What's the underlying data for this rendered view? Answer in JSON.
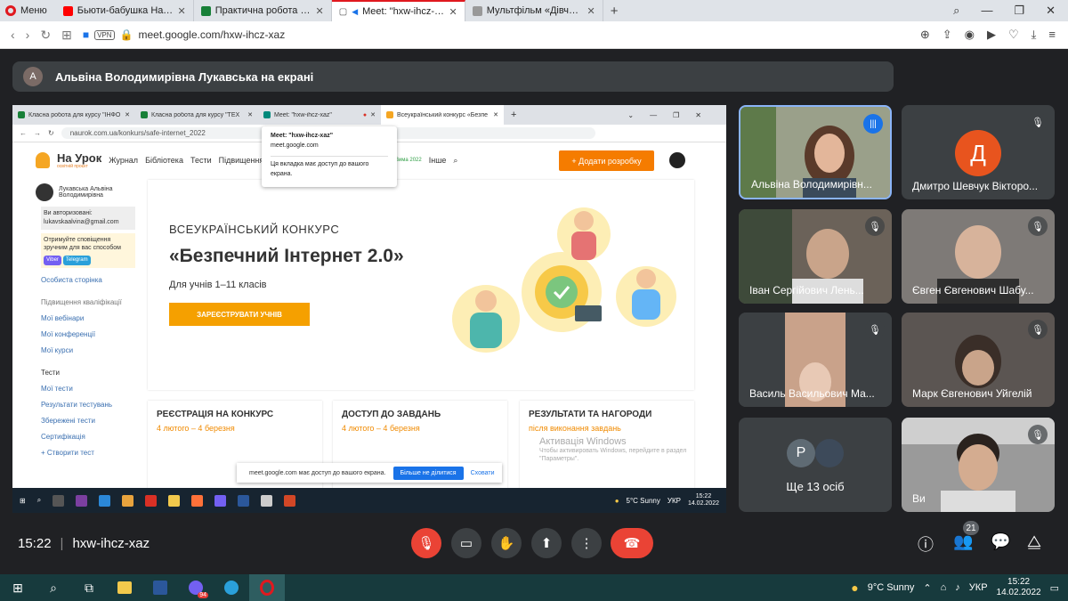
{
  "browser": {
    "menu_label": "Меню",
    "tabs": [
      {
        "title": "Бьюти-бабушка Наталья",
        "color": "#ff0000"
      },
      {
        "title": "Практична робота №4",
        "color": "#188038"
      },
      {
        "title": "Meet: \"hxw-ihcz-xaz\"",
        "color": "#1a73e8",
        "active": true
      },
      {
        "title": "Мультфільм «Дівчата з Ек",
        "color": "#999999"
      }
    ],
    "url": "meet.google.com/hxw-ihcz-xaz",
    "vpn": "VPN"
  },
  "meet": {
    "presenter_initial": "А",
    "presenting_text": "Альвіна Володимирівна Лукавська на екрані",
    "time": "15:22",
    "meeting_code": "hxw-ihcz-xaz",
    "participants_count": "21"
  },
  "shared": {
    "tabs": [
      "Класна робота для курсу \"ІНФО",
      "Класна робота для курсу \"ТЕХ",
      "Meet: \"hxw-ihcz-xaz\"",
      "Всеукраїнський конкурс «Безпе"
    ],
    "url": "naurok.com.ua/konkurs/safe-internet_2022",
    "tooltip": {
      "title": "Meet: \"hxw-ihcz-xaz\"",
      "domain": "meet.google.com",
      "note": "Ця вкладка має доступ до вашого екрана."
    },
    "site": {
      "logo": "На Урок",
      "logo_sub": "освітній проєкт",
      "nav": [
        "Журнал",
        "Бібліотека",
        "Тести",
        "Підвищення"
      ],
      "nav_extra": "Зима 2022",
      "more": "Інше",
      "add_button": "+ Додати розробку",
      "user_name": "Лукавська Альвіна Володимирівна",
      "auth_label": "Ви авторизовані:",
      "email": "lukavskaalvina@gmail.com",
      "notify": "Отримуйте сповіщення зручним для вас способом",
      "viber": "Viber",
      "telegram": "Telegram",
      "personal": "Особиста сторінка",
      "qual": "Підвищення кваліфікації",
      "webinars": "Мої вебінари",
      "confs": "Мої конференції",
      "courses": "Мої курси",
      "tests": "Тести",
      "my_tests": "Мої тести",
      "results": "Результати тестувань",
      "saved": "Збережені тести",
      "cert": "Сертифікація",
      "create": "+ Створити тест",
      "hero_sup": "ВСЕУКРАЇНСЬКИЙ КОНКУРС",
      "hero_title": "«Безпечний Інтернет 2.0»",
      "hero_sub": "Для учнів 1–11 класів",
      "register": "ЗАРЕЄСТРУВАТИ УЧНІВ",
      "cards": [
        {
          "h": "РЕЄСТРАЦІЯ НА КОНКУРС",
          "d": "4 лютого – 4 березня"
        },
        {
          "h": "ДОСТУП ДО ЗАВДАНЬ",
          "d": "4 лютого – 4 березня"
        },
        {
          "h": "РЕЗУЛЬТАТИ ТА НАГОРОДИ",
          "d": "після виконання завдань"
        }
      ]
    },
    "activate": "Активація Windows",
    "activate_sub": "Чтобы активировать Windows, перейдите в раздел \"Параметры\".",
    "share_text": "meet.google.com має доступ до вашого екрана.",
    "stop_share": "Більше не ділитися",
    "hide": "Сховати",
    "weather": "5°C Sunny",
    "lang": "УКР",
    "clock": "15:22",
    "date": "14.02.2022"
  },
  "participants": [
    {
      "name": "Альвіна Володимирівн...",
      "speaking": true,
      "bg": "#8a8f7a"
    },
    {
      "name": "Дмитро Шевчук Вікторо...",
      "initial": "Д",
      "avatar_color": "#e8541e",
      "bg": "#3c4043"
    },
    {
      "name": "Іван Сергійович Лень...",
      "bg": "#6b6259"
    },
    {
      "name": "Євген Євгенович Шабу...",
      "bg": "#7e7a77"
    },
    {
      "name": "Василь Васильович Ма...",
      "bg": "#4a4a4a"
    },
    {
      "name": "Марк Євгенович Уйгелій",
      "bg": "#5b5552"
    },
    {
      "name": "Ще 13 осіб",
      "initial": "Р",
      "bg": "#3c4043"
    },
    {
      "name": "Ви",
      "bg": "#8f8f8f"
    }
  ],
  "taskbar": {
    "weather": "9°C Sunny",
    "lang": "УКР",
    "time": "15:22",
    "date": "14.02.2022",
    "viber_badge": "94"
  }
}
